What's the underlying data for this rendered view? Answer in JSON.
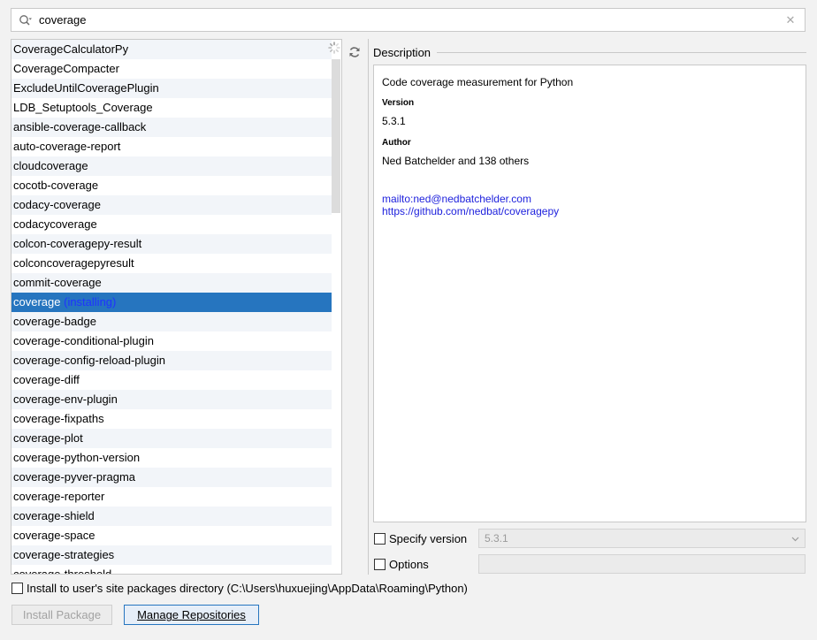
{
  "search": {
    "value": "coverage"
  },
  "packages": [
    {
      "name": "CoverageCalculatorPy",
      "status": ""
    },
    {
      "name": "CoverageCompacter",
      "status": ""
    },
    {
      "name": "ExcludeUntilCoveragePlugin",
      "status": ""
    },
    {
      "name": "LDB_Setuptools_Coverage",
      "status": ""
    },
    {
      "name": "ansible-coverage-callback",
      "status": ""
    },
    {
      "name": "auto-coverage-report",
      "status": ""
    },
    {
      "name": "cloudcoverage",
      "status": ""
    },
    {
      "name": "cocotb-coverage",
      "status": ""
    },
    {
      "name": "codacy-coverage",
      "status": ""
    },
    {
      "name": "codacycoverage",
      "status": ""
    },
    {
      "name": "colcon-coveragepy-result",
      "status": ""
    },
    {
      "name": "colconcoveragepyresult",
      "status": ""
    },
    {
      "name": "commit-coverage",
      "status": ""
    },
    {
      "name": "coverage",
      "status": "(installing)",
      "selected": true
    },
    {
      "name": "coverage-badge",
      "status": ""
    },
    {
      "name": "coverage-conditional-plugin",
      "status": ""
    },
    {
      "name": "coverage-config-reload-plugin",
      "status": ""
    },
    {
      "name": "coverage-diff",
      "status": ""
    },
    {
      "name": "coverage-env-plugin",
      "status": ""
    },
    {
      "name": "coverage-fixpaths",
      "status": ""
    },
    {
      "name": "coverage-plot",
      "status": ""
    },
    {
      "name": "coverage-python-version",
      "status": ""
    },
    {
      "name": "coverage-pyver-pragma",
      "status": ""
    },
    {
      "name": "coverage-reporter",
      "status": ""
    },
    {
      "name": "coverage-shield",
      "status": ""
    },
    {
      "name": "coverage-space",
      "status": ""
    },
    {
      "name": "coverage-strategies",
      "status": ""
    },
    {
      "name": "coverage-threshold",
      "status": ""
    }
  ],
  "description": {
    "header": "Description",
    "summary": "Code coverage measurement for Python",
    "version_label": "Version",
    "version": "5.3.1",
    "author_label": "Author",
    "author": "Ned Batchelder and 138 others",
    "links": [
      "mailto:ned@nedbatchelder.com",
      "https://github.com/nedbat/coveragepy"
    ]
  },
  "options": {
    "specify_version_label": "Specify version",
    "specify_version_value": "5.3.1",
    "options_label": "Options",
    "site_packages_label": "Install to user's site packages directory (C:\\Users\\huxuejing\\AppData\\Roaming\\Python)"
  },
  "buttons": {
    "install": "Install Package",
    "manage": "Manage Repositories"
  },
  "colors": {
    "selection": "#2675bf",
    "link": "#1f22dd",
    "installing": "#1f33ff"
  }
}
